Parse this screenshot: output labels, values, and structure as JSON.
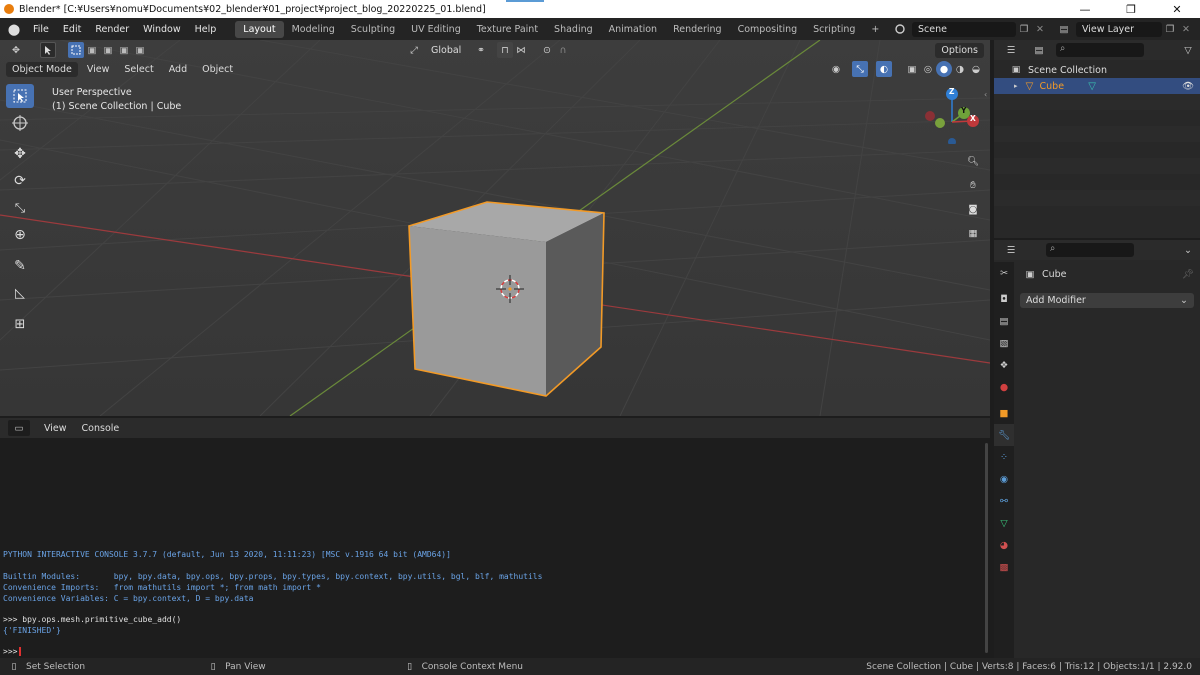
{
  "window": {
    "title": "Blender* [C:¥Users¥nomu¥Documents¥02_blender¥01_project¥project_blog_20220225_01.blend]",
    "minimize": "—",
    "maximize": "❐",
    "close": "✕"
  },
  "menus": [
    "File",
    "Edit",
    "Render",
    "Window",
    "Help"
  ],
  "workspaces": [
    "Layout",
    "Modeling",
    "Sculpting",
    "UV Editing",
    "Texture Paint",
    "Shading",
    "Animation",
    "Rendering",
    "Compositing",
    "Scripting"
  ],
  "add_workspace": "+",
  "scene": {
    "label": "Scene"
  },
  "view_layer": {
    "label": "View Layer"
  },
  "viewport": {
    "transform_orientation": "Global",
    "options_label": "Options",
    "mode": "Object Mode",
    "menu_view": "View",
    "menu_select": "Select",
    "menu_add": "Add",
    "menu_object": "Object",
    "overlay_line1": "User Perspective",
    "overlay_line2": "(1) Scene Collection | Cube",
    "gizmo": {
      "x": "X",
      "y": "Y",
      "z": "Z"
    }
  },
  "console": {
    "menu_view": "View",
    "menu_console": "Console",
    "lines": [
      "PYTHON INTERACTIVE CONSOLE 3.7.7 (default, Jun 13 2020, 11:11:23) [MSC v.1916 64 bit (AMD64)]",
      "",
      "Builtin Modules:       bpy, bpy.data, bpy.ops, bpy.props, bpy.types, bpy.context, bpy.utils, bgl, blf, mathutils",
      "Convenience Imports:   from mathutils import *; from math import *",
      "Convenience Variables: C = bpy.context, D = bpy.data",
      "",
      ">>> bpy.ops.mesh.primitive_cube_add()",
      "{'FINISHED'}",
      "",
      ">>> "
    ]
  },
  "outliner": {
    "root": "Scene Collection",
    "items": [
      {
        "label": "Cube"
      }
    ]
  },
  "properties": {
    "object_name": "Cube",
    "add_modifier": "Add Modifier"
  },
  "status": {
    "left_action": "Set Selection",
    "middle_action": "Pan View",
    "right_action": "Console Context Menu",
    "stats": "Scene Collection | Cube | Verts:8 | Faces:6 | Tris:12 | Objects:1/1 | 2.92.0"
  },
  "colors": {
    "accent": "#4772b3",
    "selection_orange": "#f29a27",
    "console_output": "#6aa3e6",
    "x_axis": "#c0393b",
    "y_axis": "#6fa23a",
    "z_axis": "#2f7fd6"
  }
}
